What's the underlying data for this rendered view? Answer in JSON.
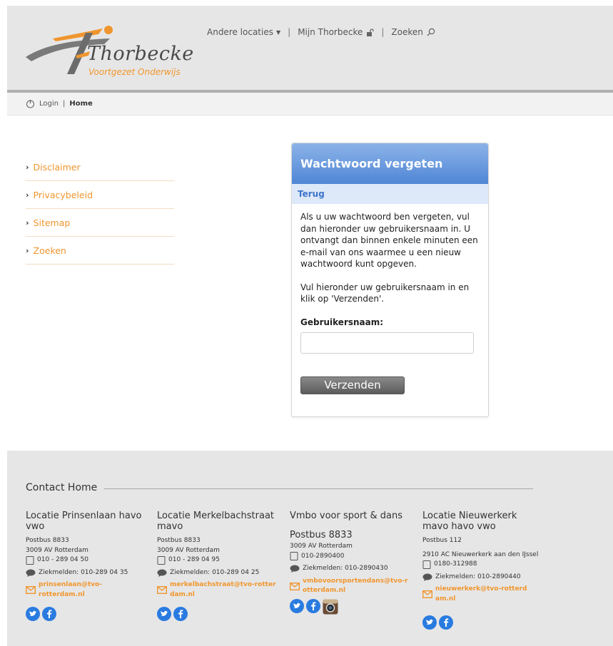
{
  "brand": {
    "name": "Thorbecke",
    "tagline": "Voortgezet Onderwijs",
    "accent": "#f0962e",
    "blue": "#4f86d6"
  },
  "topnav": {
    "other_locations": "Andere locaties",
    "my_thorbecke": "Mijn Thorbecke",
    "search": "Zoeken"
  },
  "breadcrumb": {
    "login": "Login",
    "separator": "|",
    "home": "Home"
  },
  "sidemenu": {
    "items": [
      {
        "label": "Disclaimer"
      },
      {
        "label": "Privacybeleid"
      },
      {
        "label": "Sitemap"
      },
      {
        "label": "Zoeken"
      }
    ]
  },
  "panel": {
    "title": "Wachtwoord vergeten",
    "back": "Terug",
    "intro": "Als u uw wachtwoord ben vergeten, vul dan hieronder uw gebruikersnaam in. U ontvangt dan binnen enkele minuten een e-mail van ons waarmee u een nieuw wachtwoord kunt opgeven.",
    "instruction": "Vul hieronder uw gebruikersnaam in en klik op 'Verzenden'.",
    "username_label": "Gebruikersnaam:",
    "username_value": "",
    "submit": "Verzenden"
  },
  "footer": {
    "title": "Contact Home",
    "locations": [
      {
        "name": "Locatie Prinsenlaan havo vwo",
        "postbus": "Postbus 8833",
        "city": "3009 AV Rotterdam",
        "phone": "010 - 289 04 50",
        "sick": "Ziekmelden: 010-289 04 35",
        "email": "prinsenlaan@tvo-rotterdam.nl"
      },
      {
        "name": "Locatie Merkelbachstraat mavo",
        "postbus": "Postbus 8833",
        "city": "3009 AV Rotterdam",
        "phone": "010 - 289 04 95",
        "sick": "Ziekmelden:  010-289 04 25",
        "email": "merkelbachstraat@tvo-rotterdam.nl"
      },
      {
        "name": "Vmbo voor sport & dans",
        "postbus": "Postbus 8833",
        "city": "3009 AV Rotterdam",
        "phone": "010-2890400",
        "sick": "Ziekmelden: 010-2890430",
        "email": "vmbovoorsportendans@tvo-rotterdam.nl"
      },
      {
        "name": "Locatie Nieuwerkerk mavo havo vwo",
        "postbus": "Postbus 112",
        "city": "2910 AC Nieuwerkerk aan den IJssel",
        "phone": "0180-312988",
        "sick": "Ziekmelden: 010-2890440",
        "email": "nieuwerkerk@tvo-rotterdam.nl"
      }
    ]
  }
}
